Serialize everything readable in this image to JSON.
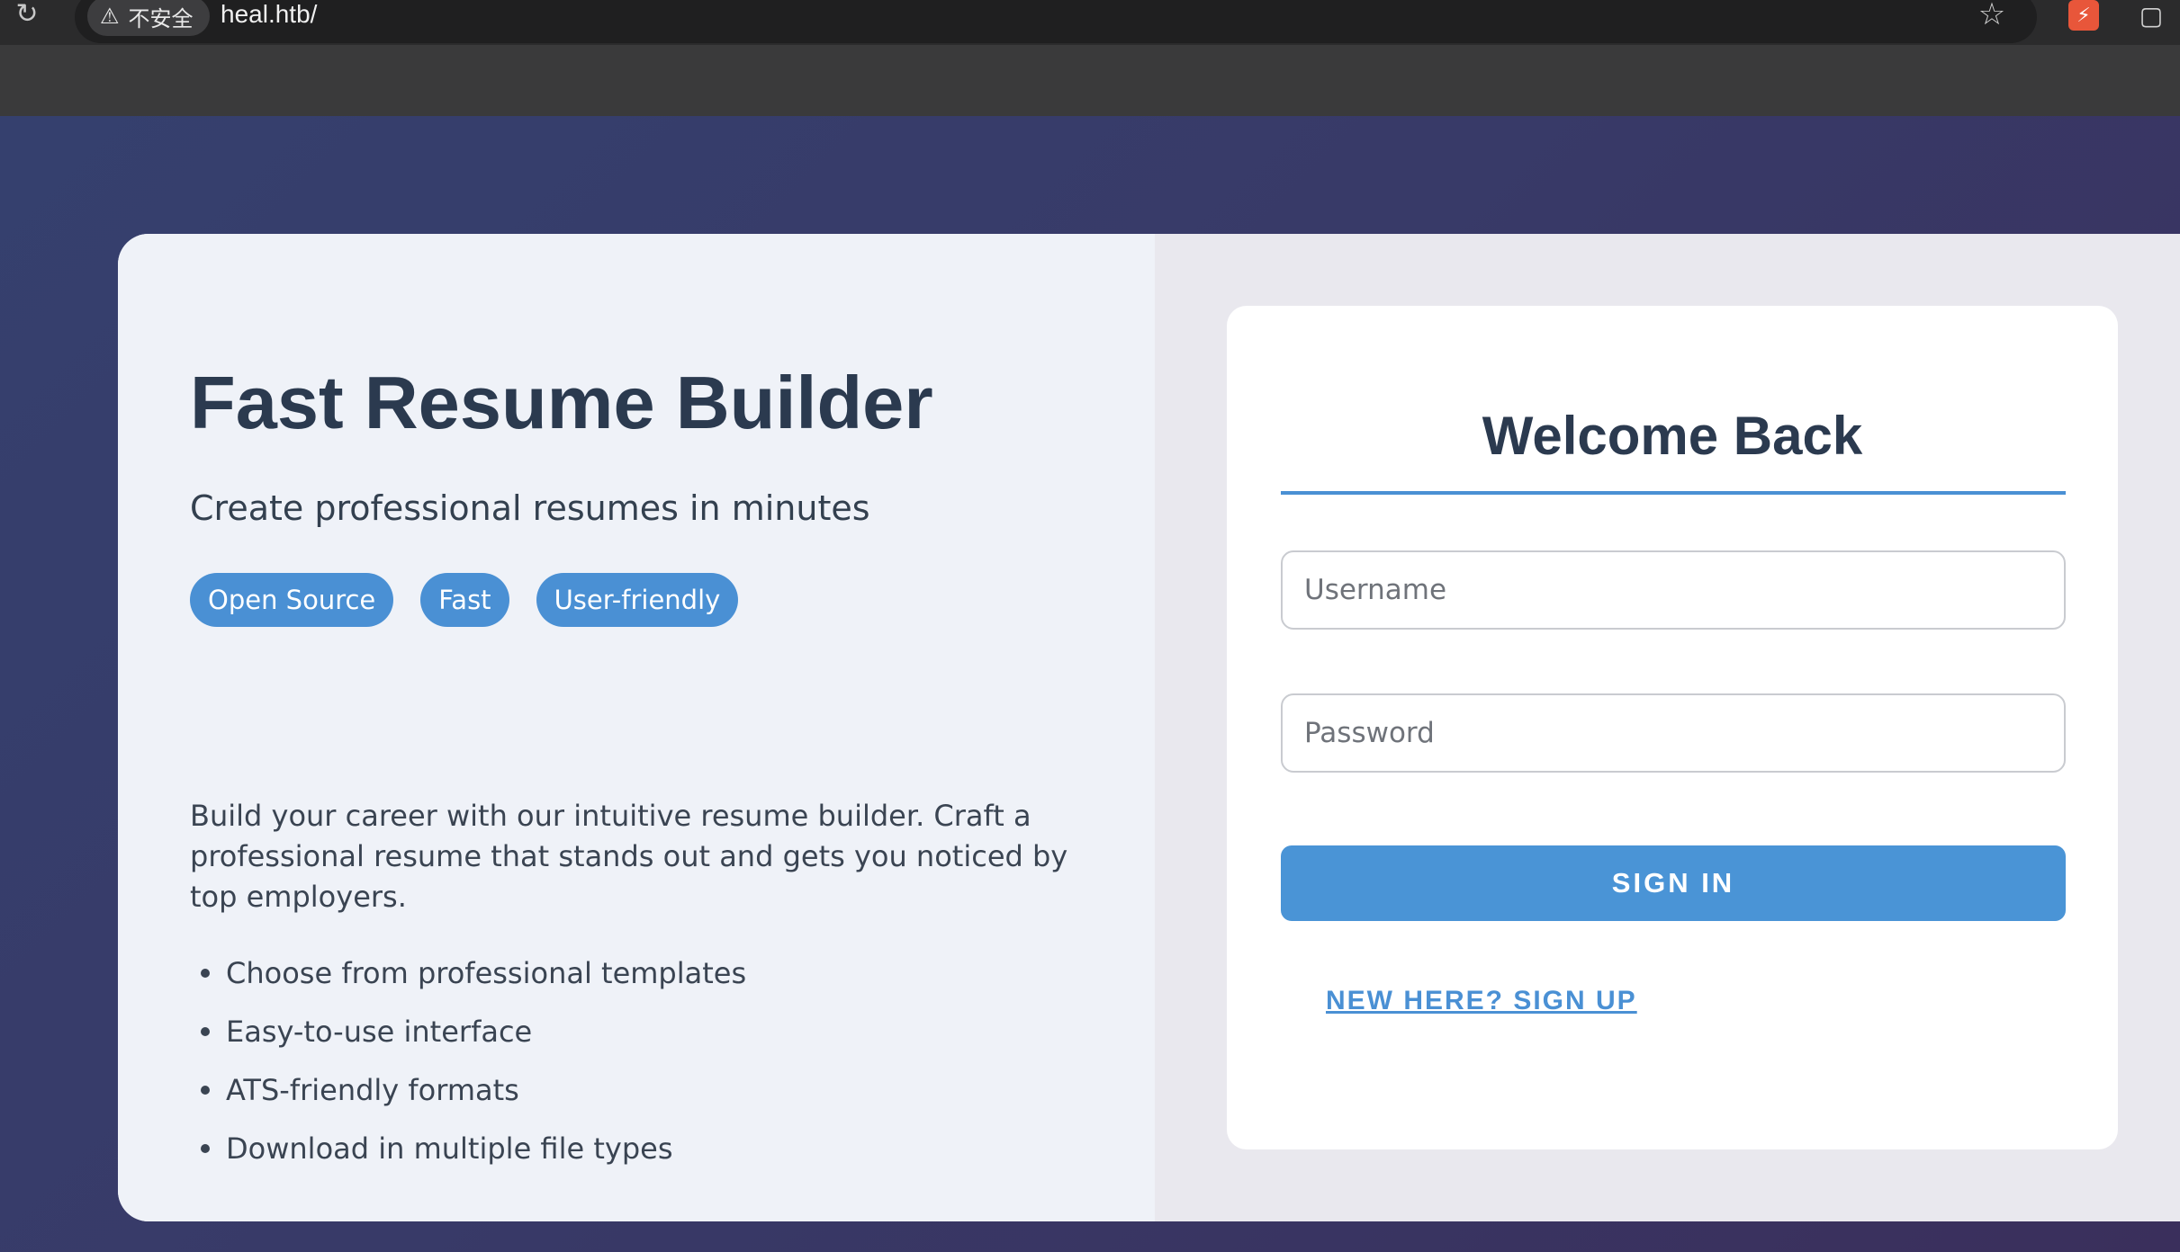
{
  "browser": {
    "security_label": "不安全",
    "url": "heal.htb/",
    "icons": {
      "reload": "reload-icon",
      "warning": "warning-icon",
      "bookmark": "star-icon",
      "extension": "extension-icon",
      "extensions_menu": "puzzle-icon"
    }
  },
  "hero": {
    "title": "Fast Resume Builder",
    "subtitle": "Create professional resumes in minutes",
    "tags": [
      "Open Source",
      "Fast",
      "User-friendly"
    ],
    "description": "Build your career with our intuitive resume builder. Craft a professional resume that stands out and gets you noticed by top employers.",
    "features": [
      "Choose from professional templates",
      "Easy-to-use interface",
      "ATS-friendly formats",
      "Download in multiple file types"
    ]
  },
  "login": {
    "title": "Welcome Back",
    "username_placeholder": "Username",
    "password_placeholder": "Password",
    "signin_label": "SIGN IN",
    "signup_label": "NEW HERE? SIGN UP"
  },
  "colors": {
    "accent": "#4a90d4",
    "heading": "#2b3a4f",
    "background_start": "#35406e",
    "background_end": "#3a2f5c"
  }
}
